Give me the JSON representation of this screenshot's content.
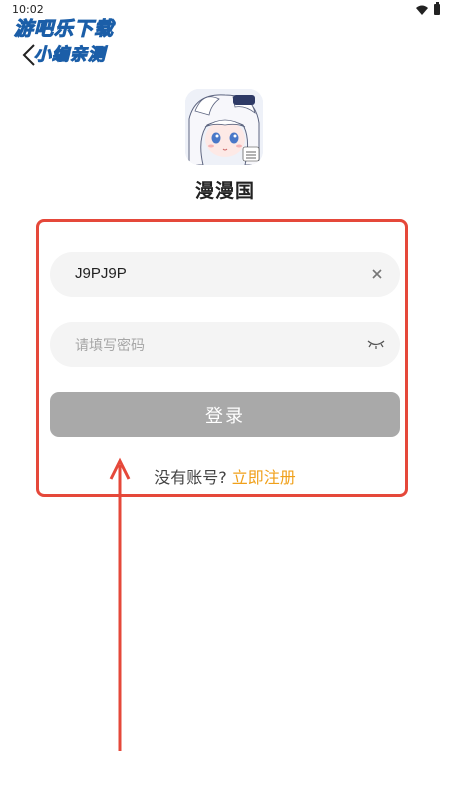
{
  "status_bar": {
    "time": "10:02"
  },
  "watermark": {
    "line1": "游吧乐下载",
    "line2": "小编亲测"
  },
  "app": {
    "name": "漫漫国",
    "logo_icon": "anime-girl-avatar-icon"
  },
  "login_form": {
    "account_value": "J9PJ9P",
    "password_placeholder": "请填写密码",
    "login_button_label": "登录",
    "register_prompt": "没有账号?",
    "register_link": "立即注册"
  },
  "colors": {
    "highlight_border": "#e5483a",
    "register_link": "#f0a01a",
    "login_button_disabled": "#a9a9a9",
    "field_background": "#f4f4f4"
  }
}
